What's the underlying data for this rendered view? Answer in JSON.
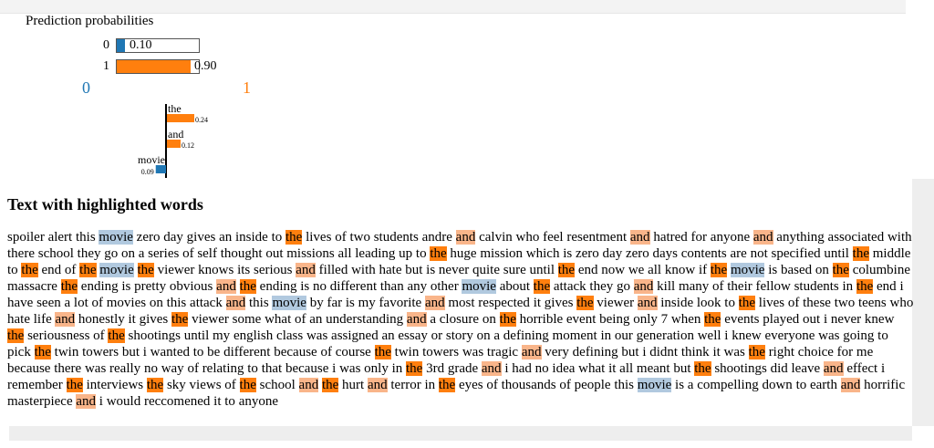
{
  "prediction": {
    "title": "Prediction probabilities",
    "classes": [
      {
        "label": "0",
        "prob": 0.1,
        "prob_text": "0.10",
        "color": "#1f77b4"
      },
      {
        "label": "1",
        "prob": 0.9,
        "prob_text": "0.90",
        "color": "#ff7f0e"
      }
    ]
  },
  "explanation": {
    "negative_class": "0",
    "positive_class": "1",
    "negative_color": "#1f77b4",
    "positive_color": "#ff7f0e"
  },
  "chart_data": [
    {
      "type": "bar",
      "title": "Prediction probabilities",
      "categories": [
        "0",
        "1"
      ],
      "values": [
        0.1,
        0.9
      ],
      "value_labels": [
        "0.10",
        "0.90"
      ],
      "xlim": [
        0,
        1
      ],
      "colors": [
        "#1f77b4",
        "#ff7f0e"
      ]
    },
    {
      "type": "bar",
      "categories": [
        "the",
        "and",
        "movie"
      ],
      "values": [
        0.24,
        0.12,
        -0.09
      ],
      "value_labels": [
        "0.24",
        "0.12",
        "0.09"
      ],
      "colors": [
        "#ff7f0e",
        "#ff7f0e",
        "#1f77b4"
      ],
      "orientation": "horizontal-diverging"
    }
  ],
  "text_section": {
    "title": "Text with highlighted words",
    "body": "spoiler alert this movie zero day gives an inside to the lives of two students andre and calvin who feel resentment and hatred for anyone and anything associated with there school they go on a series of self thought out missions all leading up to the huge mission which is zero day zero days contents are not specified until the middle to the end of the movie the viewer knows its serious and filled with hate but is never quite sure until the end now we all know if the movie is based on the columbine massacre the ending is pretty obvious and the ending is no different than any other movie about the attack they go and kill many of their fellow students in the end i have seen a lot of movies on this attack and this movie by far is my favorite and most respected it gives the viewer and inside look to the lives of these two teens who hate life and honestly it gives the viewer some what of an understanding and a closure on the horrible event being only 7 when the events played out i never knew the seriousness of the shootings until my english class was assigned an essay or story on a defining moment in our generation well i knew everyone was going to pick the twin towers but i wanted to be different because of course the twin towers was tragic and very defining but i didnt think it was the right choice for me because there was really no way of relating to that because i was only in the 3rd grade and i had no idea what it all meant but the shootings did leave and effect i remember the interviews the sky views of the school and the hurt and terror in the eyes of thousands of people this movie is a compelling down to earth and horrific masterpiece and i would reccomened it to anyone",
    "highlights": {
      "the": {
        "class": "hl-pos-strong",
        "color": "#ff7f0e"
      },
      "and": {
        "class": "hl-pos-weak",
        "color": "#f9b58a"
      },
      "movie": {
        "class": "hl-neg",
        "color": "#b1c9df"
      }
    }
  }
}
